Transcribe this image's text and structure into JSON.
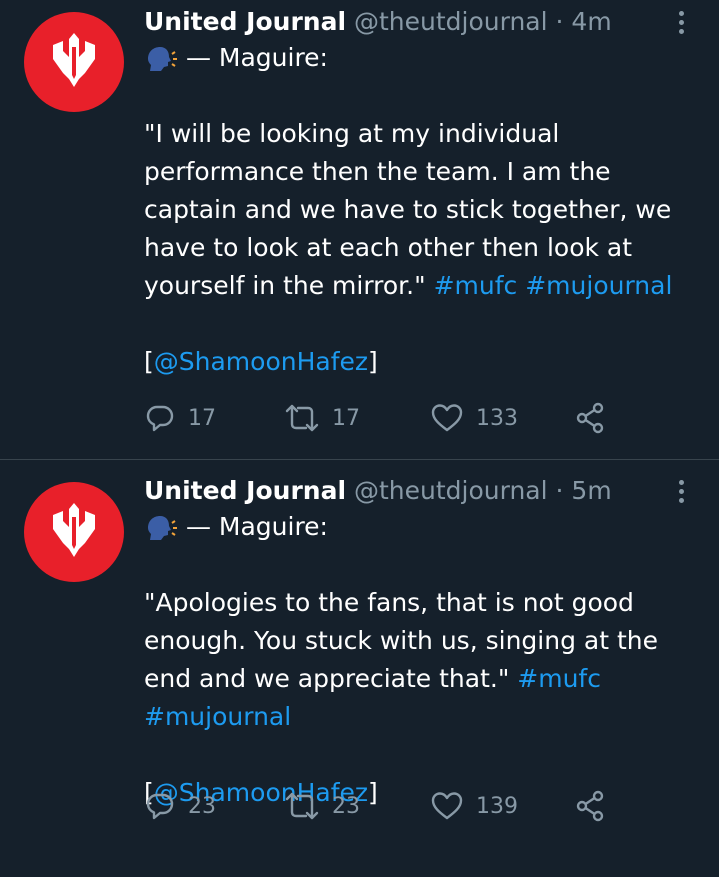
{
  "tweets": [
    {
      "name": "United Journal",
      "handle": "@theutdjournal",
      "separator": "·",
      "time": "4m",
      "speaker_line": "— Maguire:",
      "quote_lines": [
        "\"I will be looking at my individual",
        "performance then the team. I am the",
        "captain and we have to stick together, we",
        "have to look at each other then look at",
        "yourself in the mirror.\" "
      ],
      "hashtags": [
        "#mufc",
        "#mujournal"
      ],
      "credit_open": "[",
      "credit_mention": "@ShamoonHafez",
      "credit_close": "]",
      "replies": "17",
      "retweets": "17",
      "likes": "133"
    },
    {
      "name": "United Journal",
      "handle": "@theutdjournal",
      "separator": "·",
      "time": "5m",
      "speaker_line": "— Maguire:",
      "quote_lines": [
        "\"Apologies to the fans, that is not good",
        "enough. You stuck with us, singing at the",
        "end and we appreciate that.\" "
      ],
      "hashtags": [
        "#mufc",
        "#mujournal"
      ],
      "credit_open": "[",
      "credit_mention": "@ShamoonHafez",
      "credit_close": "]",
      "replies": "23",
      "retweets": "23",
      "likes": "139"
    }
  ],
  "icons": {
    "avatar": "red-circle-logo",
    "speaker": "speaking-head-emoji",
    "reply": "reply-icon",
    "retweet": "retweet-icon",
    "like": "heart-icon",
    "share": "share-icon",
    "more": "more-options-icon"
  },
  "colors": {
    "background": "#15202b",
    "text": "#ffffff",
    "muted": "#8899a6",
    "link": "#1d9bf0",
    "avatar": "#e8202a",
    "divider": "#38444d"
  }
}
